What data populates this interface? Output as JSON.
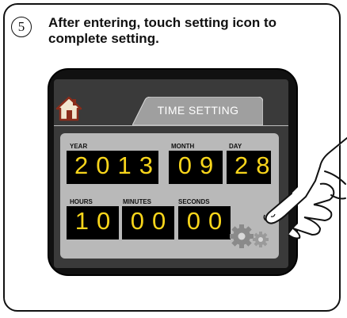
{
  "step": {
    "number": "5",
    "text": "After entering, touch setting icon to complete setting."
  },
  "device": {
    "tab_title": "TIME SETTING",
    "fields": {
      "year": {
        "label": "YEAR",
        "value": "2013"
      },
      "month": {
        "label": "MONTH",
        "value": "09"
      },
      "day": {
        "label": "DAY",
        "value": "28"
      },
      "hours": {
        "label": "HOURS",
        "value": "10"
      },
      "minutes": {
        "label": "MINUTES",
        "value": "00"
      },
      "seconds": {
        "label": "SECONDS",
        "value": "00"
      }
    },
    "digit_color": "#f8d51b",
    "icons": {
      "home": "home-icon",
      "settings": "gear-icon",
      "hand": "pointing-hand-icon"
    }
  }
}
